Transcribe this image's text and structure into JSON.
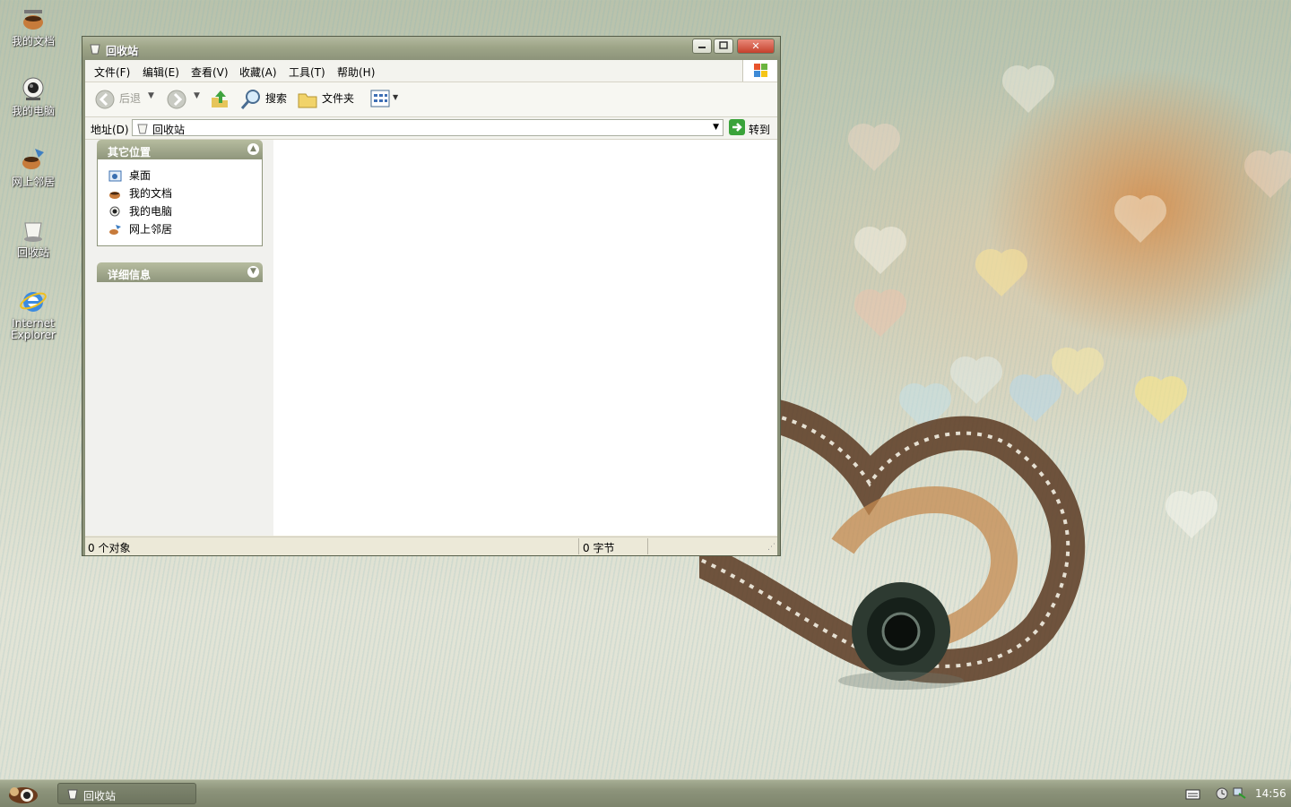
{
  "desktop": {
    "icons": [
      {
        "label": "我的文档",
        "icon": "my-documents-icon"
      },
      {
        "label": "我的电脑",
        "icon": "my-computer-icon"
      },
      {
        "label": "网上邻居",
        "icon": "network-places-icon"
      },
      {
        "label": "回收站",
        "icon": "recycle-bin-icon"
      },
      {
        "label": "Internet Explorer",
        "icon": "internet-explorer-icon"
      }
    ]
  },
  "window": {
    "title": "回收站",
    "menu": [
      "文件(F)",
      "编辑(E)",
      "查看(V)",
      "收藏(A)",
      "工具(T)",
      "帮助(H)"
    ],
    "toolbar": {
      "back": "后退",
      "search": "搜索",
      "folders": "文件夹"
    },
    "address": {
      "label": "地址(D)",
      "value": "回收站",
      "go": "转到"
    },
    "other_places": {
      "title": "其它位置",
      "items": [
        "桌面",
        "我的文档",
        "我的电脑",
        "网上邻居"
      ]
    },
    "details": {
      "title": "详细信息"
    },
    "status": {
      "objects": "0 个对象",
      "bytes": "0 字节"
    }
  },
  "taskbar": {
    "task": "回收站",
    "clock": "14:56"
  },
  "colors": {
    "theme_olive": "#8c937a",
    "title_text": "#ffffff",
    "close_red": "#c5412c",
    "go_green": "#3aa33a"
  }
}
